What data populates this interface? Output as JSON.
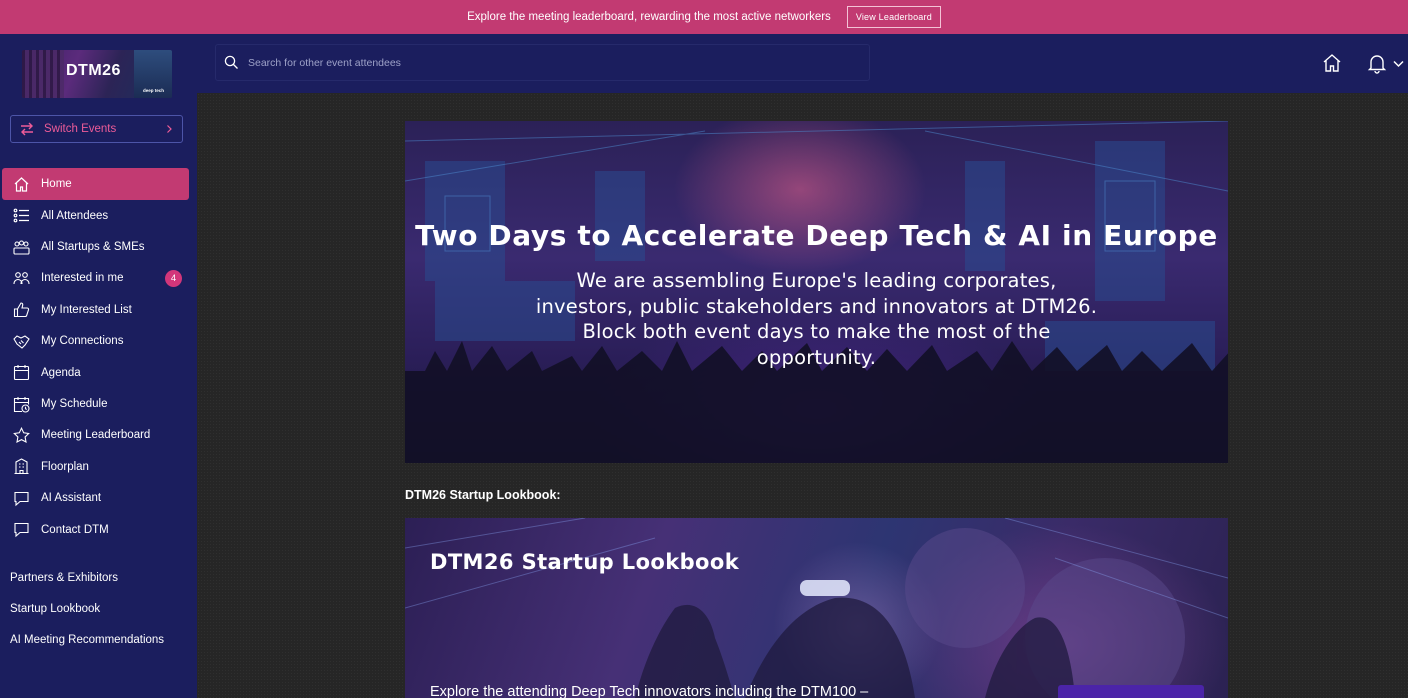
{
  "banner": {
    "text": "Explore the meeting leaderboard, rewarding the most active networkers",
    "button_label": "View Leaderboard"
  },
  "logo": {
    "text": "DTM26",
    "mini_text": "deep tech"
  },
  "switch_events": {
    "label": "Switch Events"
  },
  "search": {
    "placeholder": "Search for other event attendees"
  },
  "sidebar": {
    "items": [
      {
        "label": "Home",
        "icon": "home-icon",
        "active": true
      },
      {
        "label": "All Attendees",
        "icon": "list-icon"
      },
      {
        "label": "All Startups & SMEs",
        "icon": "group-icon"
      },
      {
        "label": "Interested in me",
        "icon": "people-icon",
        "badge": "4"
      },
      {
        "label": "My Interested List",
        "icon": "thumbs-up-icon"
      },
      {
        "label": "My Connections",
        "icon": "handshake-icon"
      },
      {
        "label": "Agenda",
        "icon": "calendar-icon"
      },
      {
        "label": "My Schedule",
        "icon": "calendar-clock-icon"
      },
      {
        "label": "Meeting Leaderboard",
        "icon": "star-icon"
      },
      {
        "label": "Floorplan",
        "icon": "building-icon"
      },
      {
        "label": "AI Assistant",
        "icon": "chat-icon"
      },
      {
        "label": "Contact DTM",
        "icon": "chat-icon"
      }
    ],
    "links": [
      {
        "label": "Partners & Exhibitors"
      },
      {
        "label": "Startup Lookbook"
      },
      {
        "label": "AI Meeting Recommendations"
      }
    ]
  },
  "hero": {
    "title": "Two Days to Accelerate Deep Tech & AI in Europe",
    "subtitle": "We are assembling Europe's leading corporates, investors, public stakeholders and innovators at DTM26. Block both event days to make the most of the opportunity."
  },
  "lookbook_section": {
    "label": "DTM26 Startup Lookbook:",
    "card_title": "DTM26 Startup Lookbook",
    "card_text": "Explore the attending Deep Tech innovators including the DTM100 –"
  },
  "colors": {
    "accent": "#c23a72",
    "sidebar_bg": "#1b1e5e",
    "banner_bg": "#c23a72",
    "link_pink": "#ee5c98"
  }
}
